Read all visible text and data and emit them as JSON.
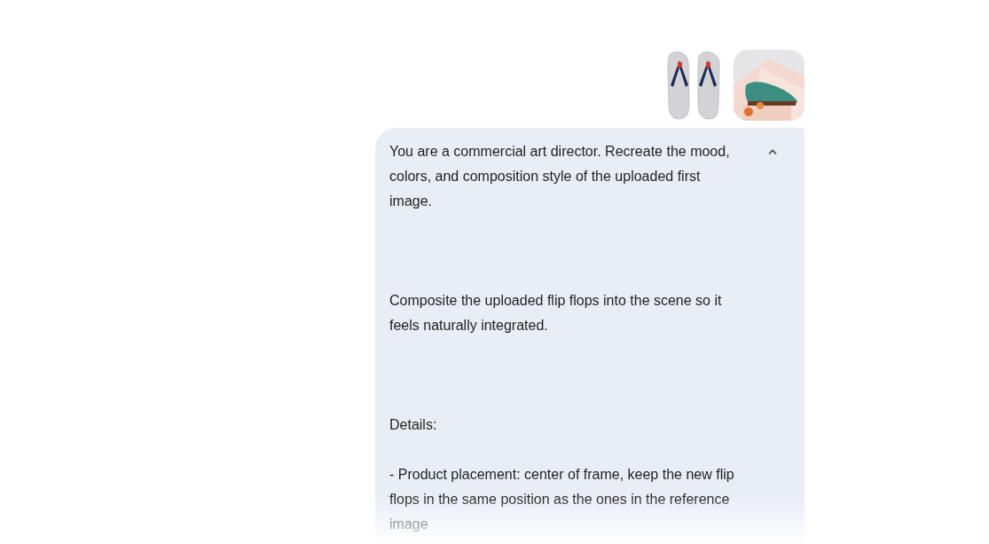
{
  "message": {
    "expanded": true,
    "paragraphs": [
      "You are a commercial art director. Recreate the mood, colors, and composition style of the uploaded first image.",
      "Composite the uploaded flip flops into the scene so it feels naturally integrated.",
      "Details:",
      "- Product placement: center of frame, keep the new flip flops in the same position as the ones in the reference image"
    ]
  }
}
